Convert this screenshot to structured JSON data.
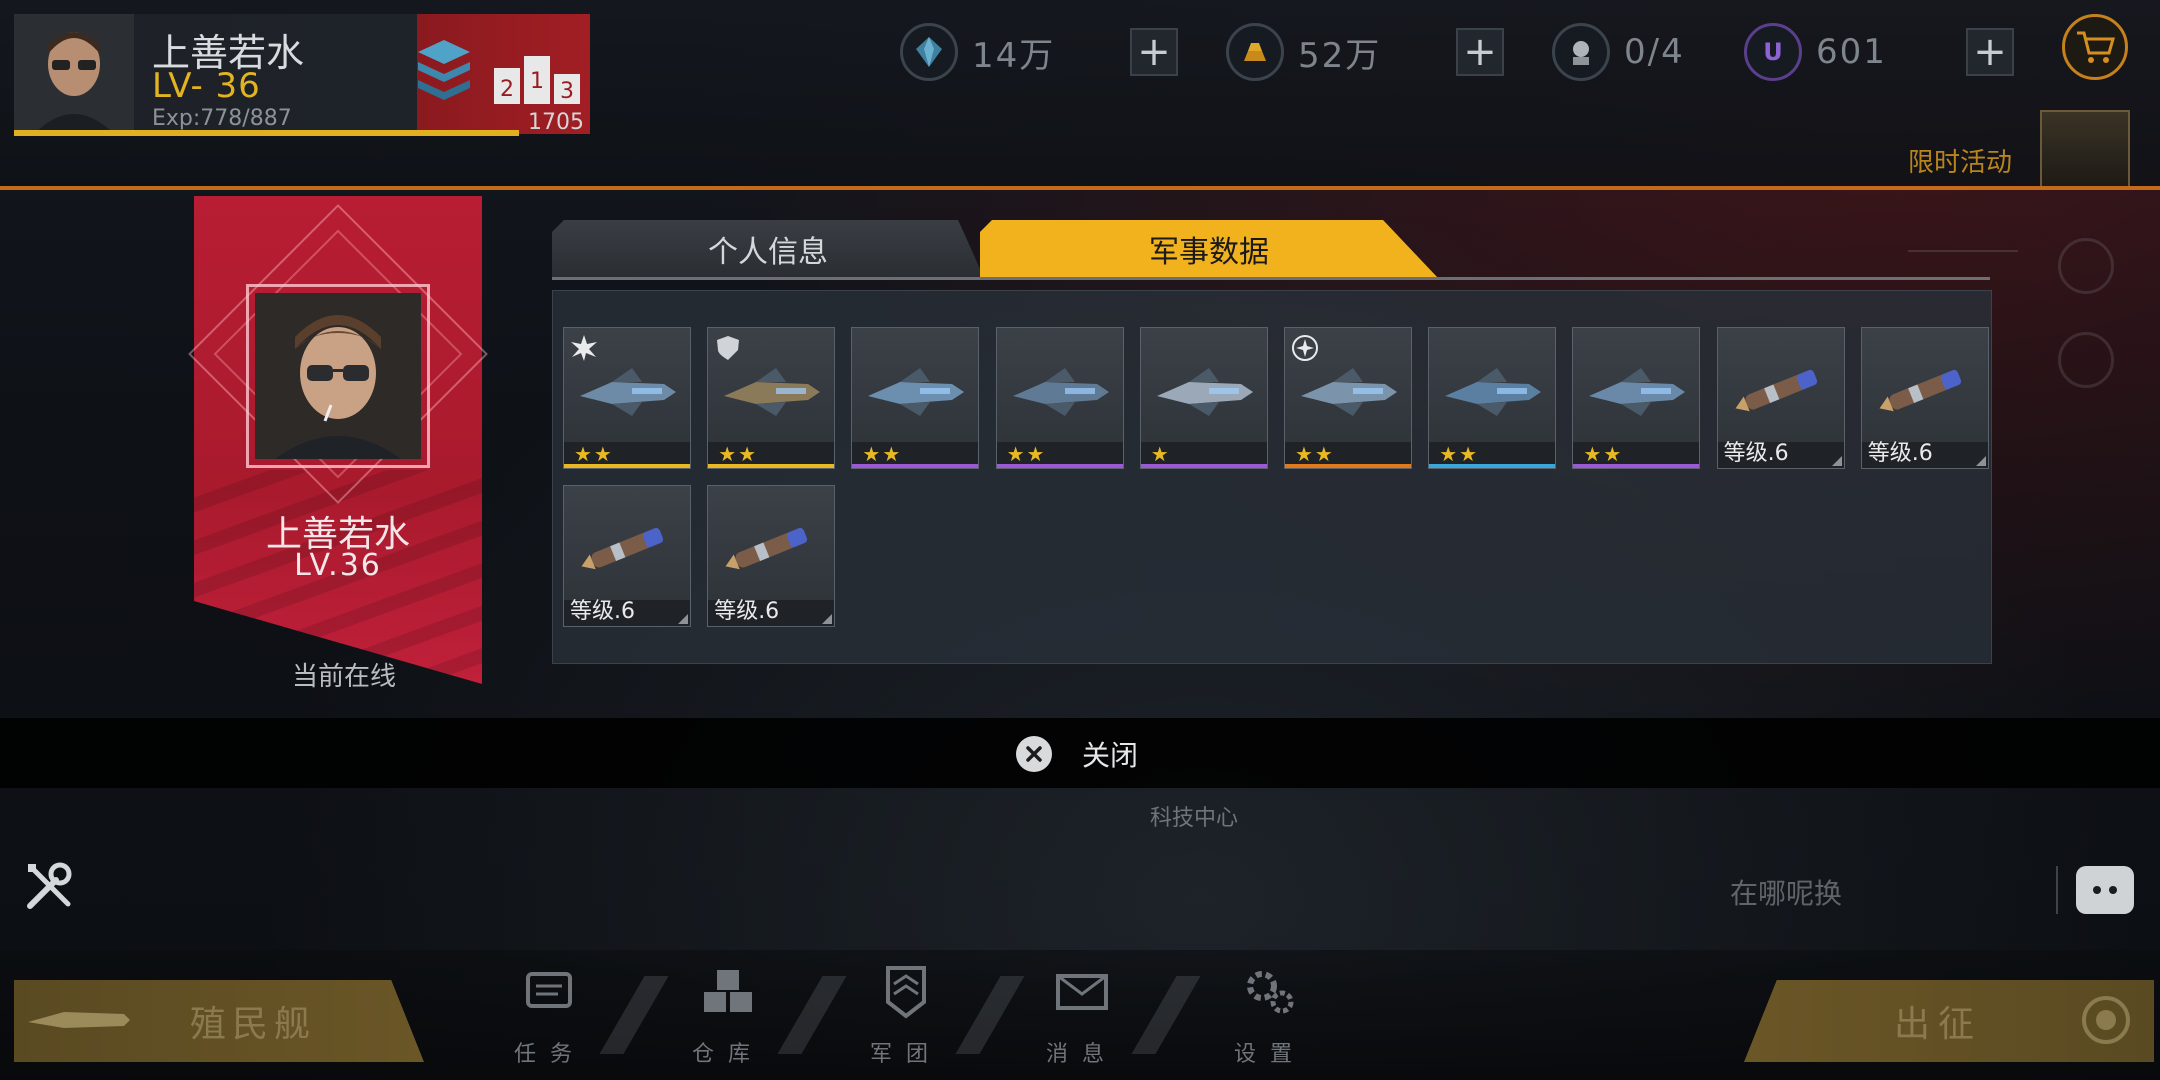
{
  "player": {
    "name": "上善若水",
    "level_label": "LV- 36",
    "exp_label": "Exp:778/887",
    "rank_score": "1705"
  },
  "resources": {
    "crystal": "14万",
    "gold": "52万",
    "units": "0/4",
    "premium": "601"
  },
  "event": {
    "label": "限时活动"
  },
  "profile_panel": {
    "name": "上善若水",
    "level": "LV.36",
    "status": "当前在线"
  },
  "tabs": [
    {
      "label": "个人信息",
      "active": false
    },
    {
      "label": "军事数据",
      "active": true
    }
  ],
  "items": [
    {
      "stars": "★★",
      "rarity_color": "#e8b923",
      "badge": "burst-icon"
    },
    {
      "stars": "★★",
      "rarity_color": "#e8b923",
      "badge": "shield-icon"
    },
    {
      "stars": "★★",
      "rarity_color": "#9b59d6"
    },
    {
      "stars": "★★",
      "rarity_color": "#9b59d6"
    },
    {
      "stars": "★",
      "rarity_color": "#9b59d6"
    },
    {
      "stars": "★★",
      "rarity_color": "#e07a1a",
      "badge": "spark-icon"
    },
    {
      "stars": "★★",
      "rarity_color": "#3aa6d9"
    },
    {
      "stars": "★★",
      "rarity_color": "#9b59d6"
    },
    {
      "level": "等级.6"
    },
    {
      "level": "等级.6"
    },
    {
      "level": "等级.6"
    },
    {
      "level": "等级.6"
    }
  ],
  "close": {
    "label": "关闭"
  },
  "world": {
    "tech_center": "科技中心",
    "chat_placeholder": "在哪呢换"
  },
  "bottom_nav": {
    "colony": "殖民舰",
    "sortie": "出征",
    "items": [
      {
        "label": "任务",
        "icon": "mission-icon"
      },
      {
        "label": "仓库",
        "icon": "warehouse-icon"
      },
      {
        "label": "军团",
        "icon": "legion-icon"
      },
      {
        "label": "消息",
        "icon": "message-icon"
      },
      {
        "label": "设置",
        "icon": "settings-icon"
      }
    ]
  },
  "colors": {
    "accent_gold": "#f2b21d",
    "banner_red": "#b81d33",
    "hud_orange": "#c5691b"
  }
}
